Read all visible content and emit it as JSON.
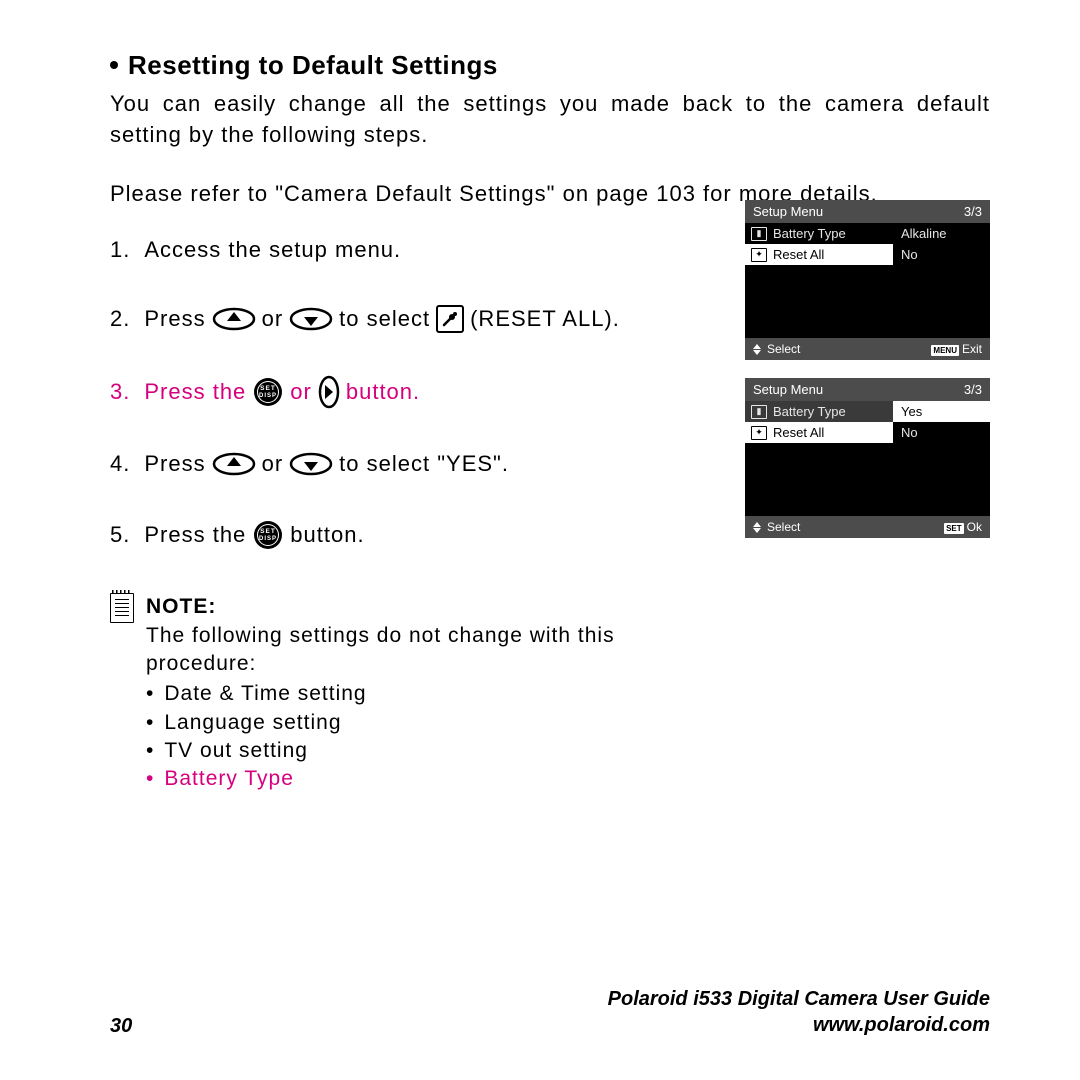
{
  "heading": "Resetting to Default Settings",
  "intro": "You can easily change all the settings you made back to the camera default setting by the following steps.",
  "ref": "Please refer to \"Camera Default Settings\" on page 103 for more details.",
  "steps": {
    "s1": {
      "num": "1.",
      "text": "Access the setup menu."
    },
    "s2": {
      "num": "2.",
      "a": "Press",
      "b": "or",
      "c": "to select",
      "d": "(RESET ALL)."
    },
    "s3": {
      "num": "3.",
      "a": "Press the",
      "b": "or",
      "c": "button."
    },
    "s4": {
      "num": "4.",
      "a": "Press",
      "b": "or",
      "c": "to select \"YES\"."
    },
    "s5": {
      "num": "5.",
      "a": "Press the",
      "b": "button."
    }
  },
  "note": {
    "label": "NOTE:",
    "text": "The following settings do not change with this procedure:",
    "items": [
      "Date & Time setting",
      "Language setting",
      "TV out setting",
      "Battery Type"
    ]
  },
  "screen1": {
    "title": "Setup Menu",
    "page": "3/3",
    "rows": [
      {
        "label": "Battery Type",
        "val": "Alkaline",
        "sel": false
      },
      {
        "label": "Reset All",
        "val": "No",
        "sel": true
      }
    ],
    "foot_left": "Select",
    "foot_right": "Exit",
    "foot_badge": "MENU"
  },
  "screen2": {
    "title": "Setup Menu",
    "page": "3/3",
    "rows": [
      {
        "label": "Battery Type",
        "val": "Yes",
        "sel": false,
        "valsel": true
      },
      {
        "label": "Reset All",
        "val": "No",
        "sel": true,
        "valsel": false
      }
    ],
    "foot_left": "Select",
    "foot_right": "Ok",
    "foot_badge": "SET"
  },
  "footer": {
    "page": "30",
    "guide": "Polaroid i533 Digital Camera User Guide",
    "url": "www.polaroid.com"
  }
}
